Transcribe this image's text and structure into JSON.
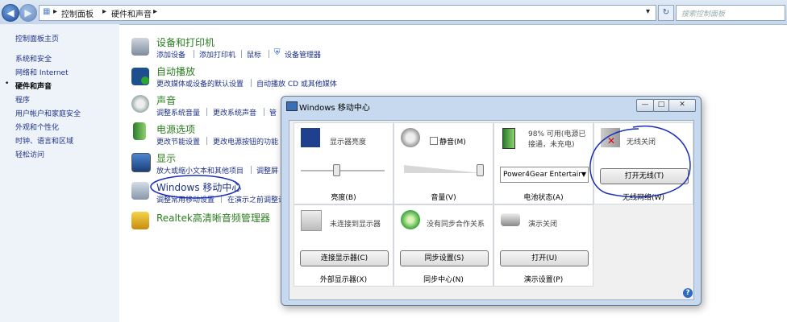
{
  "address_bar": {
    "breadcrumb": [
      "控制面板",
      "硬件和声音"
    ],
    "search_placeholder": "搜索控制面板"
  },
  "left_nav": {
    "items": [
      {
        "label": "控制面板主页"
      },
      {
        "label": "系统和安全"
      },
      {
        "label": "网络和 Internet"
      },
      {
        "label": "硬件和声音"
      },
      {
        "label": "程序"
      },
      {
        "label": "用户帐户和家庭安全"
      },
      {
        "label": "外观和个性化"
      },
      {
        "label": "时钟、语言和区域"
      },
      {
        "label": "轻松访问"
      }
    ]
  },
  "categories": {
    "devices": {
      "title": "设备和打印机",
      "links": [
        "添加设备",
        "添加打印机",
        "鼠标",
        "设备管理器"
      ]
    },
    "autoplay": {
      "title": "自动播放",
      "links": [
        "更改媒体或设备的默认设置",
        "自动播放 CD 或其他媒体"
      ]
    },
    "sound": {
      "title": "声音",
      "links": [
        "调整系统音量",
        "更改系统声音",
        "管"
      ]
    },
    "power": {
      "title": "电源选项",
      "links": [
        "更改节能设置",
        "更改电源按钮的功能"
      ]
    },
    "display": {
      "title": "显示",
      "links": [
        "放大或缩小文本和其他项目",
        "调整屏"
      ]
    },
    "mobility": {
      "title": "Windows 移动中心",
      "links": [
        "调整常用移动设置",
        "在演示之前调整设"
      ]
    },
    "realtek": {
      "title": "Realtek高清晰音频管理器"
    }
  },
  "dialog": {
    "title": "Windows 移动中心",
    "tiles": {
      "brightness": {
        "label": "亮度(B)",
        "status": "显示器亮度",
        "level": 0.42
      },
      "volume": {
        "label": "音量(V)",
        "mute_label": "静音(M)",
        "muted": false,
        "level": 0.98
      },
      "battery": {
        "label": "电池状态(A)",
        "status": "98% 可用(电源已接通，未充电)",
        "plan": "Power4Gear Entertair"
      },
      "wireless": {
        "label": "无线网络(W)",
        "status": "无线关闭",
        "button": "打开无线(T)"
      },
      "display_ext": {
        "label": "外部显示器(X)",
        "status": "未连接到显示器",
        "button": "连接显示器(C)"
      },
      "sync": {
        "label": "同步中心(N)",
        "status": "没有同步合作关系",
        "button": "同步设置(S)"
      },
      "presentation": {
        "label": "演示设置(P)",
        "status": "演示关闭",
        "button": "打开(U)"
      }
    }
  },
  "colors": {
    "annotation": "#1a2fb8",
    "category_title": "#2b7d1f",
    "link": "#1e3287"
  }
}
